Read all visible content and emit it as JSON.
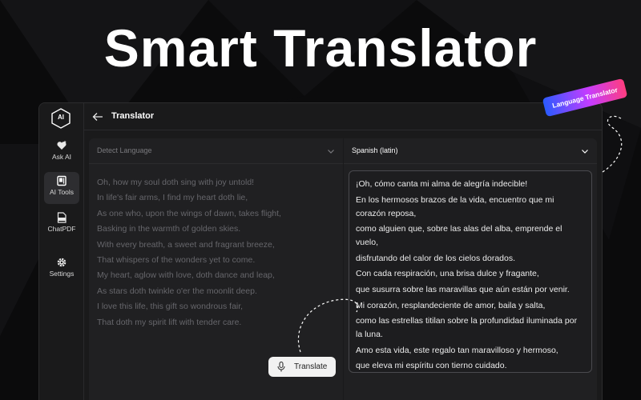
{
  "headline": "Smart Translator",
  "badge": "Language Translator",
  "logo": "AI",
  "sidebar": {
    "items": [
      {
        "label": "Ask AI",
        "icon": "heart-sparkle-icon",
        "active": false
      },
      {
        "label": "AI Tools",
        "icon": "book-icon",
        "active": true
      },
      {
        "label": "ChatPDF",
        "icon": "pdf-icon",
        "active": false
      },
      {
        "label": "Settings",
        "icon": "gear-icon",
        "active": false
      }
    ]
  },
  "topbar": {
    "title": "Translator"
  },
  "source": {
    "language": "Detect Language",
    "lines": [
      "Oh, how my soul doth sing with joy untold!",
      "In life's fair arms, I find my heart doth lie,",
      "As one who, upon the wings of dawn, takes flight,",
      "Basking in the warmth of golden skies.",
      "With every breath, a sweet and fragrant breeze,",
      "That whispers of the wonders yet to come.",
      "My heart, aglow with love, doth dance and leap,",
      "As stars doth twinkle o'er the moonlit deep.",
      "I love this life, this gift so wondrous fair,",
      "That doth my spirit lift with tender care."
    ]
  },
  "target": {
    "language": "Spanish (latin)",
    "lines": [
      "¡Oh, cómo canta mi alma de alegría indecible!",
      "En los hermosos brazos de la vida, encuentro que mi corazón reposa,",
      "como alguien que, sobre las alas del alba, emprende el vuelo,",
      "disfrutando del calor de los cielos dorados.",
      "Con cada respiración, una brisa dulce y fragante,",
      "que susurra sobre las maravillas que aún están por venir.",
      "Mi corazón, resplandeciente de amor, baila y salta,",
      "como las estrellas titilan sobre la profundidad iluminada por la luna.",
      "Amo esta vida, este regalo tan maravilloso y hermoso,",
      "que eleva mi espíritu con tierno cuidado."
    ]
  },
  "translate_button": "Translate",
  "colors": {
    "background": "#0b0b0c",
    "panel": "#202022",
    "accent_start": "#2a5bff",
    "accent_end": "#ff3d7f"
  }
}
